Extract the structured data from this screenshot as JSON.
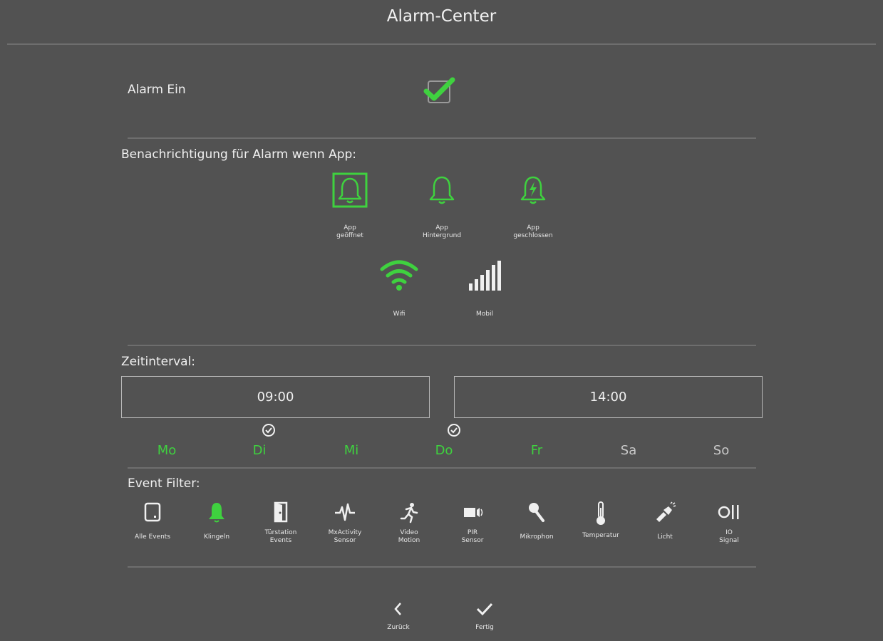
{
  "header": {
    "title": "Alarm-Center"
  },
  "alarm": {
    "label": "Alarm Ein",
    "checked": true
  },
  "notification": {
    "heading": "Benachrichtigung für Alarm wenn App:",
    "states": [
      {
        "label": "App\ngeöffnet",
        "icon": "bell-icon",
        "selected": true
      },
      {
        "label": "App\nHintergrund",
        "icon": "bell-icon",
        "selected": false
      },
      {
        "label": "App\ngeschlossen",
        "icon": "bell-bolt-icon",
        "selected": false
      }
    ],
    "connections": [
      {
        "label": "Wifi",
        "icon": "wifi-icon",
        "active": true
      },
      {
        "label": "Mobil",
        "icon": "signal-bars-icon",
        "active": false
      }
    ]
  },
  "interval": {
    "heading": "Zeitinterval:",
    "start": "09:00",
    "end": "14:00"
  },
  "days": [
    {
      "label": "Mo",
      "active": true
    },
    {
      "label": "Di",
      "active": true
    },
    {
      "label": "Mi",
      "active": true
    },
    {
      "label": "Do",
      "active": true
    },
    {
      "label": "Fr",
      "active": true
    },
    {
      "label": "Sa",
      "active": false
    },
    {
      "label": "So",
      "active": false
    }
  ],
  "event_filter": {
    "heading": "Event Filter:",
    "items": [
      {
        "label": "Alle Events",
        "icon": "tablet-icon",
        "active": false
      },
      {
        "label": "Klingeln",
        "icon": "bell-icon",
        "active": true
      },
      {
        "label": "Türstation\nEvents",
        "icon": "door-icon",
        "active": false
      },
      {
        "label": "MxActivity\nSensor",
        "icon": "activity-icon",
        "active": false
      },
      {
        "label": "Video\nMotion",
        "icon": "running-person-icon",
        "active": false
      },
      {
        "label": "PIR\nSensor",
        "icon": "camera-icon",
        "active": false
      },
      {
        "label": "Mikrophon",
        "icon": "microphone-icon",
        "active": false
      },
      {
        "label": "Temperatur",
        "icon": "thermometer-icon",
        "active": false
      },
      {
        "label": "Licht",
        "icon": "flashlight-icon",
        "active": false
      },
      {
        "label": "IO\nSignal",
        "icon": "io-signal-icon",
        "active": false
      }
    ]
  },
  "footer": {
    "back_label": "Zurück",
    "done_label": "Fertig"
  },
  "colors": {
    "accent": "#3fd13f",
    "background": "#525252"
  }
}
